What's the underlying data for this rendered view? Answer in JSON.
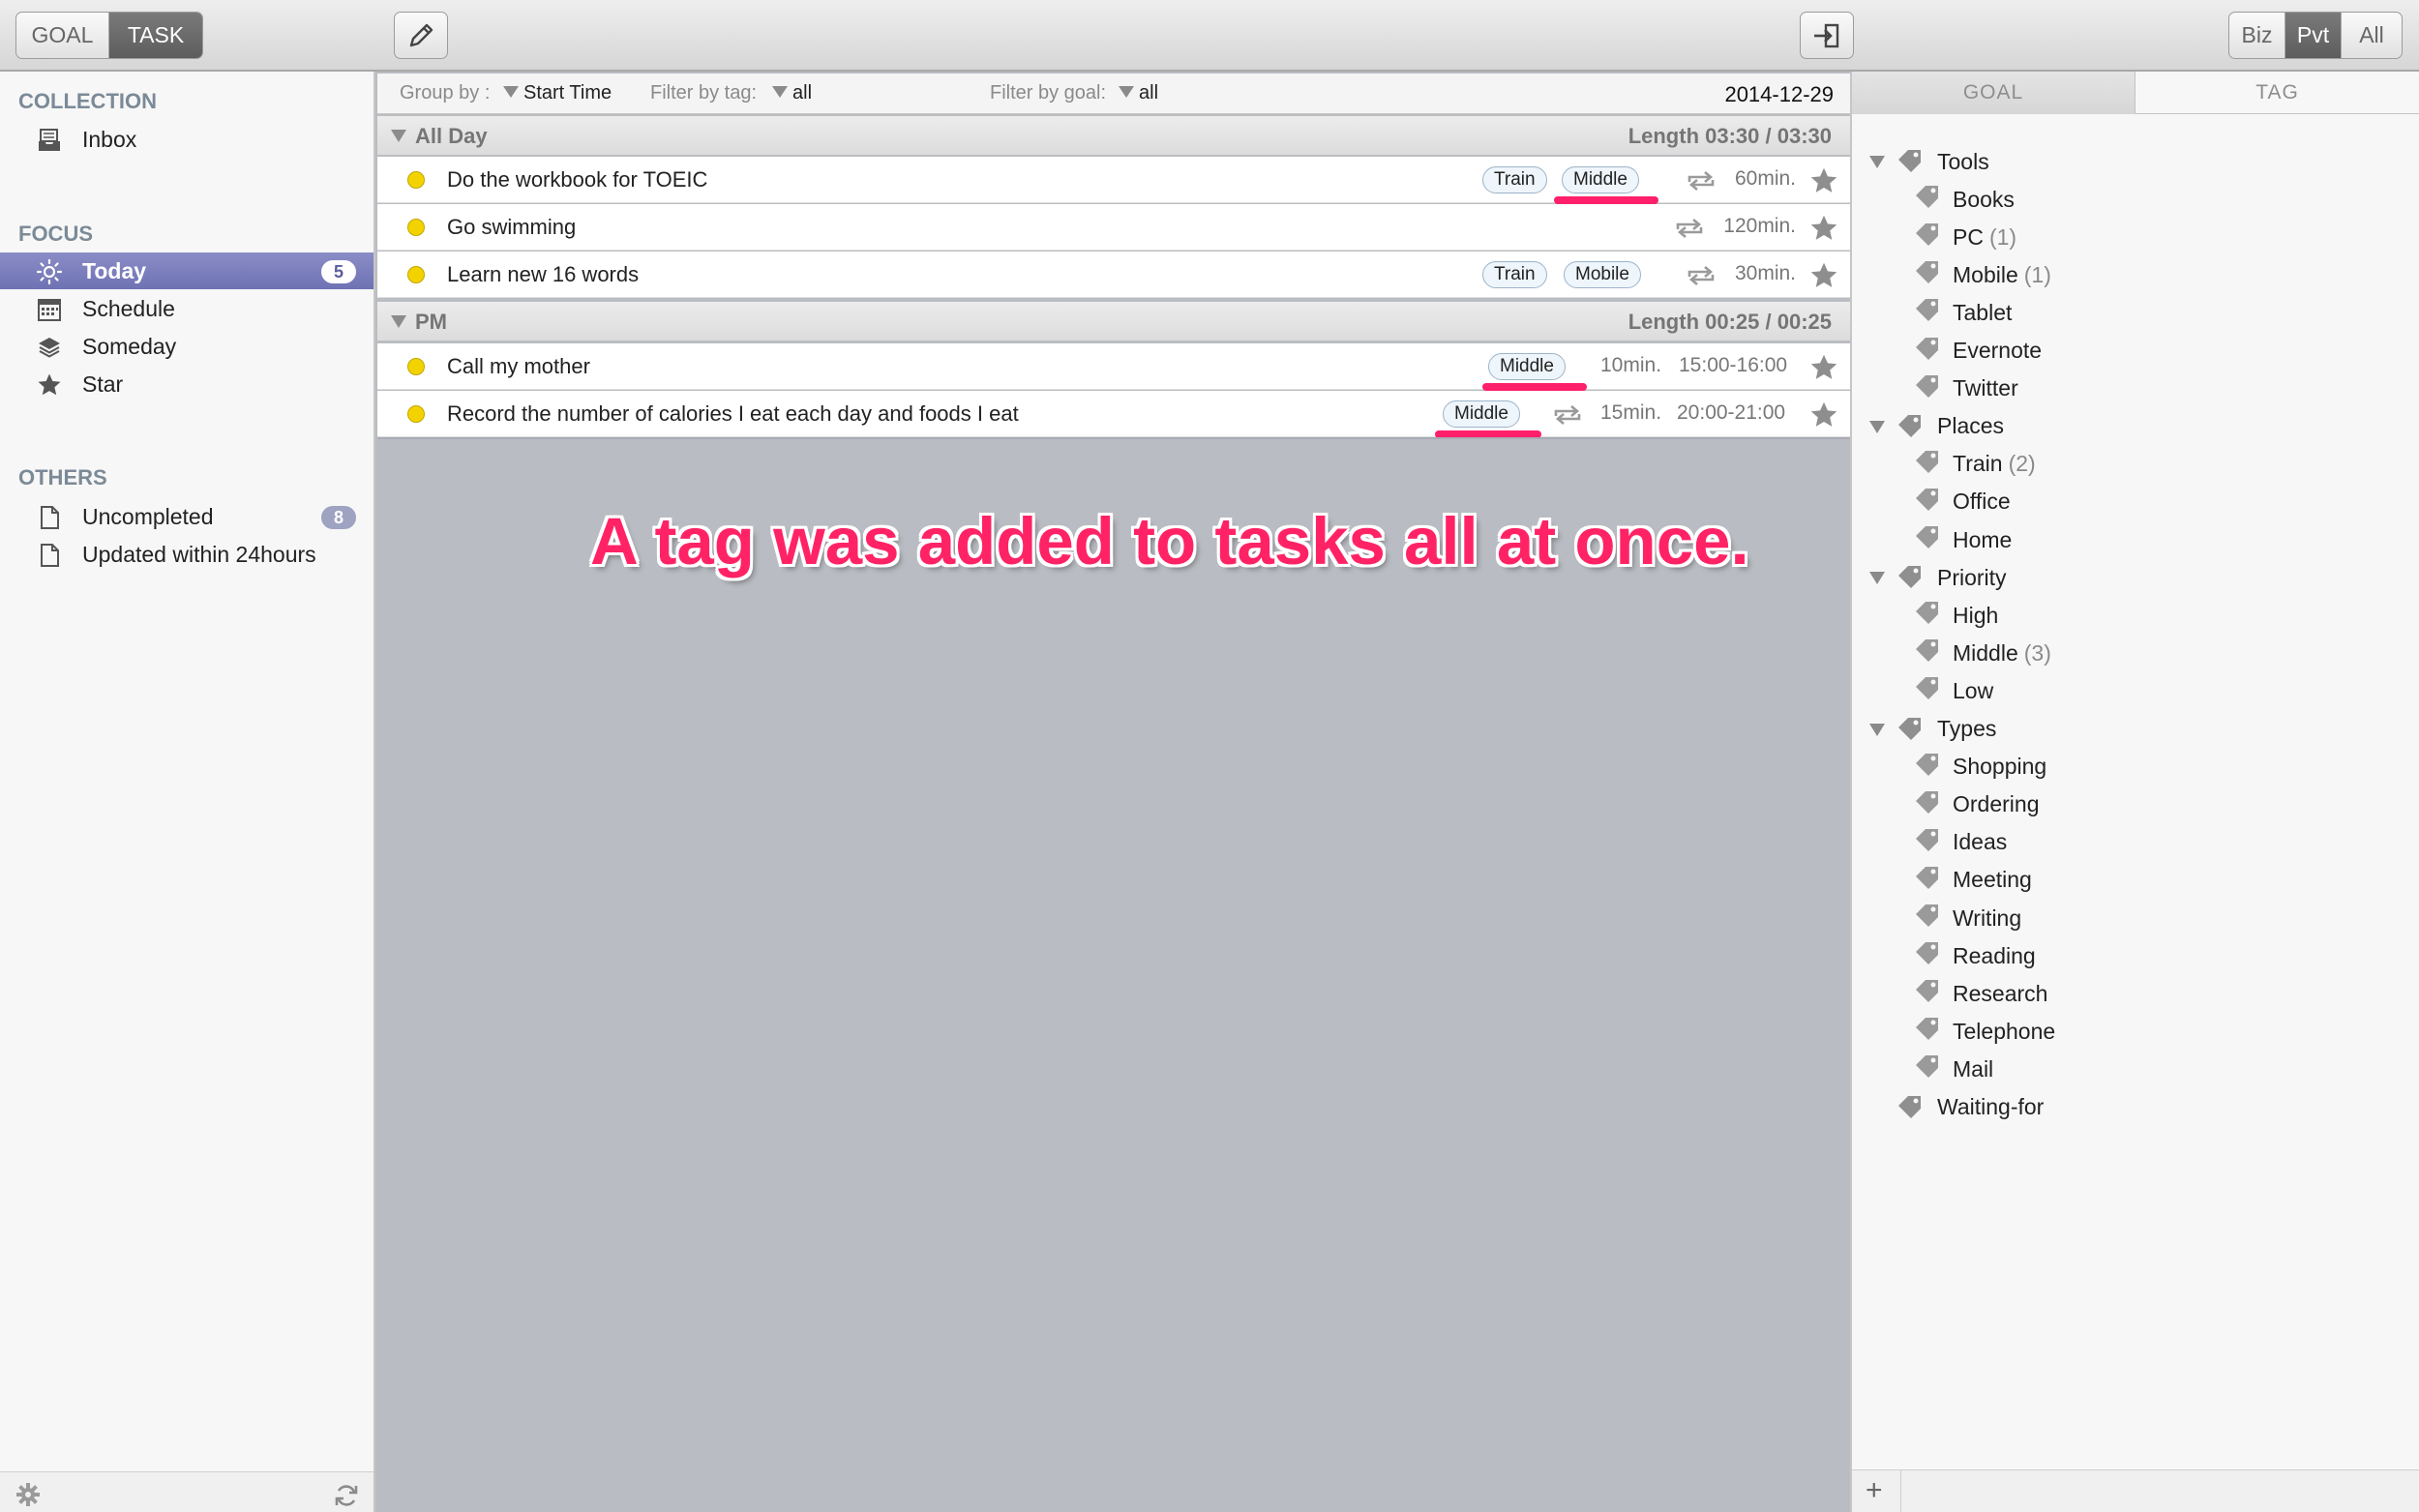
{
  "toolbar": {
    "mode_tabs": [
      "GOAL",
      "TASK"
    ],
    "active_mode": "TASK",
    "scope_tabs": [
      "Biz",
      "Pvt",
      "All"
    ],
    "active_scope": "Pvt",
    "edit_icon": "pencil-icon",
    "export_icon": "sign-in-icon"
  },
  "sidebar": {
    "collection_title": "COLLECTION",
    "collection_items": [
      {
        "label": "Inbox",
        "icon": "inbox-icon"
      }
    ],
    "focus_title": "FOCUS",
    "focus_items": [
      {
        "label": "Today",
        "icon": "sun-icon",
        "badge": "5",
        "active": true
      },
      {
        "label": "Schedule",
        "icon": "calendar-icon"
      },
      {
        "label": "Someday",
        "icon": "layers-icon"
      },
      {
        "label": "Star",
        "icon": "star-icon"
      }
    ],
    "others_title": "OTHERS",
    "other_items": [
      {
        "label": "Uncompleted",
        "icon": "document-icon",
        "badge": "8"
      },
      {
        "label": "Updated within 24hours",
        "icon": "document-icon"
      }
    ],
    "footer_icons": [
      "gear-icon",
      "sync-icon"
    ]
  },
  "filters": {
    "group_by_label": "Group by :",
    "group_by_value": "Start Time",
    "tag_label": "Filter by tag:",
    "tag_value": "all",
    "goal_label": "Filter by goal:",
    "goal_value": "all",
    "date": "2014-12-29"
  },
  "groups": [
    {
      "name": "All Day",
      "length": "Length 03:30 / 03:30",
      "tasks": [
        {
          "title": "Do the workbook for TOEIC",
          "tags": [
            "Train",
            "Middle"
          ],
          "repeat": true,
          "duration": "60min.",
          "time": ""
        },
        {
          "title": "Go swimming",
          "tags": [],
          "repeat": true,
          "duration": "120min.",
          "time": ""
        },
        {
          "title": "Learn new 16 words",
          "tags": [
            "Train",
            "Mobile"
          ],
          "repeat": true,
          "duration": "30min.",
          "time": ""
        }
      ]
    },
    {
      "name": "PM",
      "length": "Length 00:25 / 00:25",
      "tasks": [
        {
          "title": "Call my mother",
          "tags": [
            "Middle"
          ],
          "repeat": false,
          "duration": "10min.",
          "time": "15:00-16:00"
        },
        {
          "title": "Record the number of calories I eat each day and foods I eat",
          "tags": [
            "Middle"
          ],
          "repeat": true,
          "duration": "15min.",
          "time": "20:00-21:00"
        }
      ]
    }
  ],
  "annotation": "A tag was added to tasks all at once.",
  "annotation_color": "#ff2366",
  "right_panel": {
    "tabs": [
      "GOAL",
      "TAG"
    ],
    "active_tab": "GOAL",
    "tree": [
      {
        "label": "Tools",
        "children": [
          {
            "label": "Books"
          },
          {
            "label": "PC",
            "count": "(1)"
          },
          {
            "label": "Mobile",
            "count": "(1)"
          },
          {
            "label": "Tablet"
          },
          {
            "label": "Evernote"
          },
          {
            "label": "Twitter"
          }
        ]
      },
      {
        "label": "Places",
        "children": [
          {
            "label": "Train",
            "count": "(2)"
          },
          {
            "label": "Office"
          },
          {
            "label": "Home"
          }
        ]
      },
      {
        "label": "Priority",
        "children": [
          {
            "label": "High"
          },
          {
            "label": "Middle",
            "count": "(3)"
          },
          {
            "label": "Low"
          }
        ]
      },
      {
        "label": "Types",
        "children": [
          {
            "label": "Shopping"
          },
          {
            "label": "Ordering"
          },
          {
            "label": "Ideas"
          },
          {
            "label": "Meeting"
          },
          {
            "label": "Writing"
          },
          {
            "label": "Reading"
          },
          {
            "label": "Research"
          },
          {
            "label": "Telephone"
          },
          {
            "label": "Mail"
          }
        ]
      },
      {
        "label": "Waiting-for",
        "children": []
      }
    ],
    "footer_add": "+"
  }
}
